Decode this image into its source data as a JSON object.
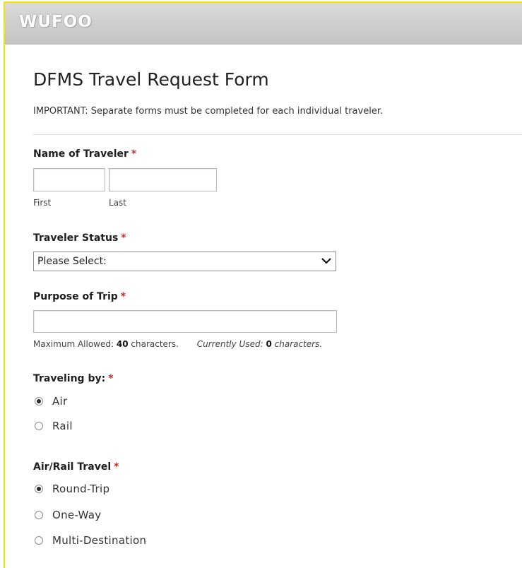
{
  "app": {
    "logo_text": "WUFOO"
  },
  "form": {
    "title": "DFMS Travel Request Form",
    "description": "IMPORTANT: Separate forms must be completed for each individual traveler."
  },
  "required_marker": "*",
  "fields": {
    "name": {
      "label": "Name of Traveler",
      "first_label": "First",
      "last_label": "Last",
      "first_value": "",
      "last_value": ""
    },
    "status": {
      "label": "Traveler Status",
      "selected": "Please Select:"
    },
    "purpose": {
      "label": "Purpose of Trip",
      "value": "",
      "max_prefix": "Maximum Allowed:",
      "max_value": "40",
      "max_suffix": "characters.",
      "used_prefix": "Currently Used:",
      "used_value": "0",
      "used_suffix": "characters."
    },
    "traveling_by": {
      "label": "Traveling by:",
      "options": [
        {
          "label": "Air",
          "checked": true
        },
        {
          "label": "Rail",
          "checked": false
        }
      ]
    },
    "air_rail": {
      "label": "Air/Rail Travel",
      "options": [
        {
          "label": "Round-Trip",
          "checked": true
        },
        {
          "label": "One-Way",
          "checked": false
        },
        {
          "label": "Multi-Destination",
          "checked": false
        }
      ]
    }
  },
  "icons": {
    "select_arrow": "chevron-down-icon",
    "radio": "radio-button"
  }
}
